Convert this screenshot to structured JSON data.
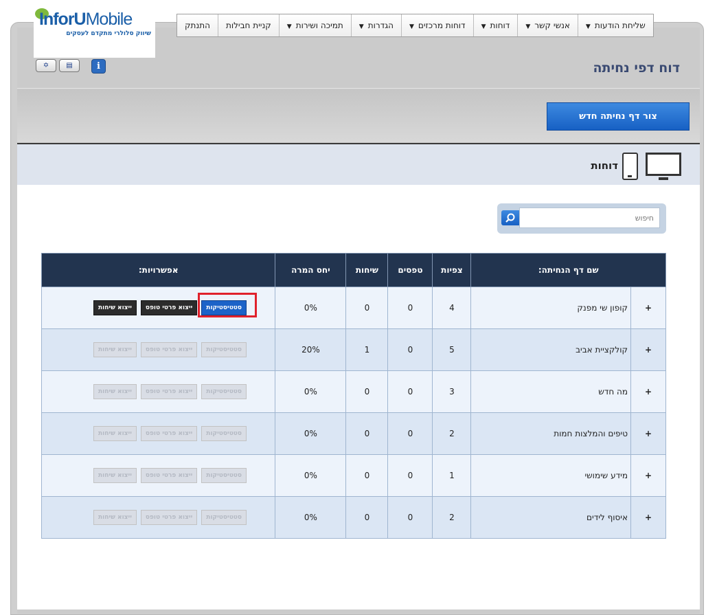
{
  "brand": {
    "logo_part1": "InforU",
    "logo_part2": "Mobile",
    "tagline": "שיווק סלולרי מתקדם לעסקים"
  },
  "nav": [
    {
      "label": "שליחת הודעות",
      "has_caret": true
    },
    {
      "label": "אנשי קשר",
      "has_caret": true
    },
    {
      "label": "דוחות",
      "has_caret": true
    },
    {
      "label": "דוחות מרכזים",
      "has_caret": true
    },
    {
      "label": "הגדרות",
      "has_caret": true
    },
    {
      "label": "תמיכה ושירות",
      "has_caret": true
    },
    {
      "label": "קניית חבילות",
      "has_caret": false
    },
    {
      "label": "התנתק",
      "has_caret": false
    }
  ],
  "page_title": "דוח דפי נחיתה",
  "create_button": "צור דף נחיתה חדש",
  "section_title": "דוחות",
  "search": {
    "placeholder": "חיפוש"
  },
  "table": {
    "headers": [
      "שם דף הנחיתה:",
      "צפיות",
      "טפסים",
      "שיחות",
      "יחס המרה",
      "אפשרויות:"
    ],
    "option_labels": {
      "stats": "סטטיסטיקות",
      "export_forms": "ייצוא פרטי טופס",
      "export_calls": "ייצוא שיחות"
    },
    "rows": [
      {
        "name": "קופון שי מפנק",
        "views": "4",
        "forms": "0",
        "calls": "0",
        "rate": "0%"
      },
      {
        "name": "קולקציית אביב",
        "views": "5",
        "forms": "0",
        "calls": "1",
        "rate": "20%"
      },
      {
        "name": "מה חדש",
        "views": "3",
        "forms": "0",
        "calls": "0",
        "rate": "0%"
      },
      {
        "name": "טיפים והמלצות חמות",
        "views": "2",
        "forms": "0",
        "calls": "0",
        "rate": "0%"
      },
      {
        "name": "מידע שימושי",
        "views": "1",
        "forms": "0",
        "calls": "0",
        "rate": "0%"
      },
      {
        "name": "איסוף לידים",
        "views": "2",
        "forms": "0",
        "calls": "0",
        "rate": "0%"
      }
    ]
  },
  "plus_symbol": "+",
  "info_symbol": "i",
  "colors": {
    "accent": "#1c63c8",
    "header_bg": "#22344f",
    "highlight": "#e0212b"
  }
}
